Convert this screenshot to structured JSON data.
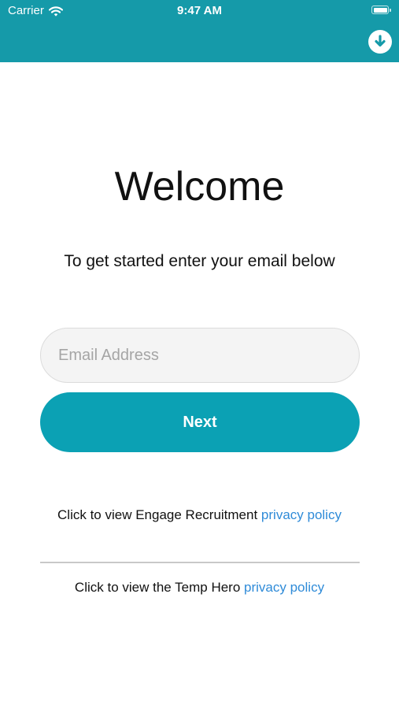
{
  "status_bar": {
    "carrier": "Carrier",
    "time": "9:47 AM",
    "wifi_icon": "wifi-icon",
    "battery_icon": "battery-icon"
  },
  "header": {
    "background_color": "#159aa9",
    "download_icon": "download-circle-icon"
  },
  "welcome": {
    "title": "Welcome",
    "subtitle": "To get started enter your email below"
  },
  "form": {
    "email_placeholder": "Email Address",
    "email_value": "",
    "next_label": "Next",
    "button_color": "#0ba1b4"
  },
  "policies": [
    {
      "prefix": "Click to view Engage Recruitment ",
      "link_text": "privacy policy"
    },
    {
      "prefix": "Click to view the Temp Hero ",
      "link_text": "privacy policy"
    }
  ],
  "link_color": "#2f8bd8"
}
